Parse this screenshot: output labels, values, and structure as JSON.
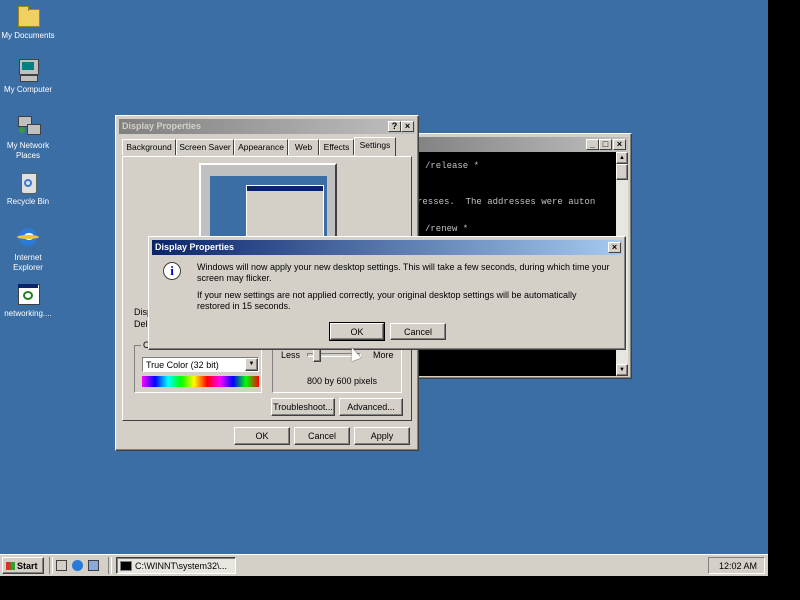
{
  "desktop": {
    "icons": [
      {
        "label": "My Documents"
      },
      {
        "label": "My Computer"
      },
      {
        "label": "My Network",
        "label2": "Places"
      },
      {
        "label": "Recycle Bin"
      },
      {
        "label": "Internet",
        "label2": "Explorer"
      },
      {
        "label": "networking...."
      }
    ]
  },
  "console": {
    "lines": [
      "/release *",
      "resses.  The addresses were auton",
      "/renew *"
    ]
  },
  "display_properties": {
    "title": "Display Properties",
    "help_glyph": "?",
    "close_glyph": "×",
    "tabs": [
      "Background",
      "Screen Saver",
      "Appearance",
      "Web",
      "Effects",
      "Settings"
    ],
    "display_label_1": "Disp",
    "display_label_2": "Dele",
    "colors_group_label": "Co",
    "colors_value": "True Color (32 bit)",
    "slider_less": "Less",
    "slider_more": "More",
    "resolution": "800 by 600 pixels",
    "troubleshoot": "Troubleshoot...",
    "advanced": "Advanced...",
    "ok": "OK",
    "cancel": "Cancel",
    "apply": "Apply"
  },
  "confirm_dialog": {
    "title": "Display Properties",
    "message1": "Windows will now apply your new desktop settings. This will take a few seconds, during which time your screen may flicker.",
    "message2": "If your new settings are not applied correctly, your original desktop settings will be automatically restored in 15 seconds.",
    "ok": "OK",
    "cancel": "Cancel",
    "close_glyph": "×"
  },
  "taskbar": {
    "start": "Start",
    "task_label": "C:\\WINNT\\system32\\...",
    "clock": "12:02 AM"
  },
  "colors": {
    "desktop": "#3a6ea5",
    "title_active_start": "#0a246a",
    "title_active_end": "#a6caf0",
    "face": "#d4d0c8"
  }
}
